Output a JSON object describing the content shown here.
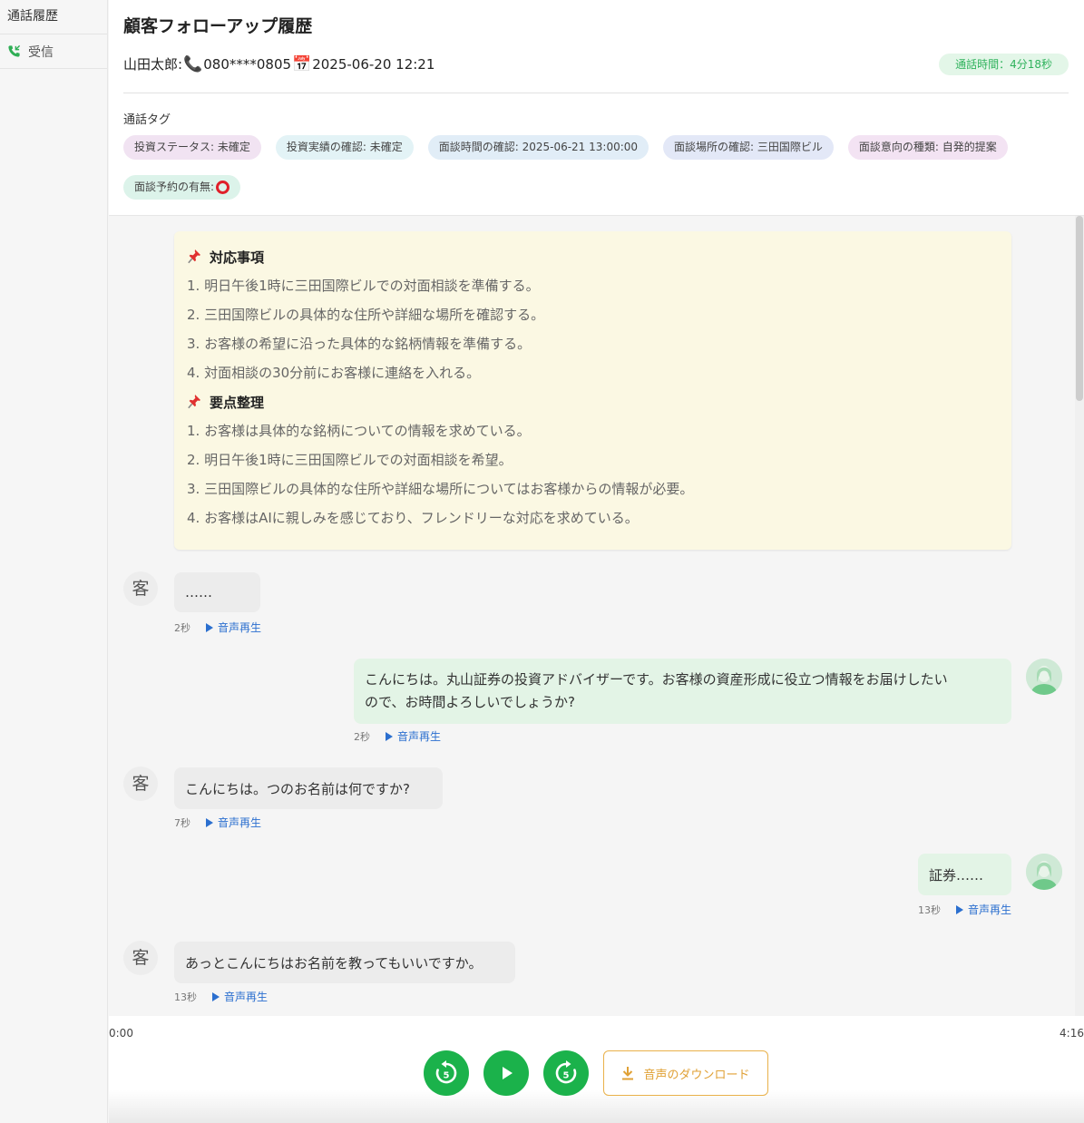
{
  "sidebar": {
    "title": "通話履歴",
    "items": [
      {
        "label": "受信",
        "icon": "incoming-call-icon"
      }
    ]
  },
  "header": {
    "title": "顧客フォローアップ履歴",
    "customer_name": "山田太郎:",
    "phone": "080****0805",
    "datetime": "2025-06-20 12:21",
    "duration_label": "通話時間：4分18秒"
  },
  "tags": {
    "label": "通話タグ",
    "items": [
      {
        "text": "投資ステータス: 未確定",
        "color": "#f1e3f2"
      },
      {
        "text": "投資実績の確認: 未確定",
        "color": "#e3f3f6"
      },
      {
        "text": "面談時間の確認: 2025-06-21 13:00:00",
        "color": "#e1edf7"
      },
      {
        "text": "面談場所の確認: 三田国際ビル",
        "color": "#e3e8f7"
      },
      {
        "text": "面談意向の種類: 自発的提案",
        "color": "#f3e3f3"
      },
      {
        "text": "面談予約の有無:",
        "color": "#dcf3ea",
        "circle": true
      }
    ]
  },
  "summary": {
    "actions_title": "対応事項",
    "actions": [
      "1. 明日午後1時に三田国際ビルでの対面相談を準備する。",
      "2. 三田国際ビルの具体的な住所や詳細な場所を確認する。",
      "3. お客様の希望に沿った具体的な銘柄情報を準備する。",
      "4. 対面相談の30分前にお客様に連絡を入れる。"
    ],
    "points_title": "要点整理",
    "points": [
      "1. お客様は具体的な銘柄についての情報を求めている。",
      "2. 明日午後1時に三田国際ビルでの対面相談を希望。",
      "3. 三田国際ビルの具体的な住所や詳細な場所についてはお客様からの情報が必要。",
      "4. お客様はAIに親しみを感じており、フレンドリーな対応を求めている。"
    ]
  },
  "messages": [
    {
      "speaker": "customer",
      "avatar": "客",
      "text": "……",
      "time": "2秒",
      "play": "音声再生"
    },
    {
      "speaker": "agent",
      "text_lines": [
        "こんにちは。丸山証券の投資アドバイザーです。お客様の資産形成に役立つ情報をお届けしたい",
        "ので、お時間よろしいでしょうか?"
      ],
      "time": "2秒",
      "play": "音声再生"
    },
    {
      "speaker": "customer",
      "avatar": "客",
      "text": "こんにちは。つのお名前は何ですか?",
      "time": "7秒",
      "play": "音声再生"
    },
    {
      "speaker": "agent",
      "text": "証券……",
      "time": "13秒",
      "play": "音声再生"
    },
    {
      "speaker": "customer",
      "avatar": "客",
      "text": "あっとこんにちはお名前を教ってもいいですか。",
      "time": "13秒",
      "play": "音声再生"
    }
  ],
  "player": {
    "current_time": "0:00",
    "total_time": "4:16",
    "rewind_seconds": "5",
    "forward_seconds": "5",
    "download_label": "音声のダウンロード"
  },
  "colors": {
    "accent_green": "#1bb24b",
    "download_orange": "#e0a136",
    "link_blue": "#2b6fcf",
    "summary_bg": "#fbf8e3"
  }
}
